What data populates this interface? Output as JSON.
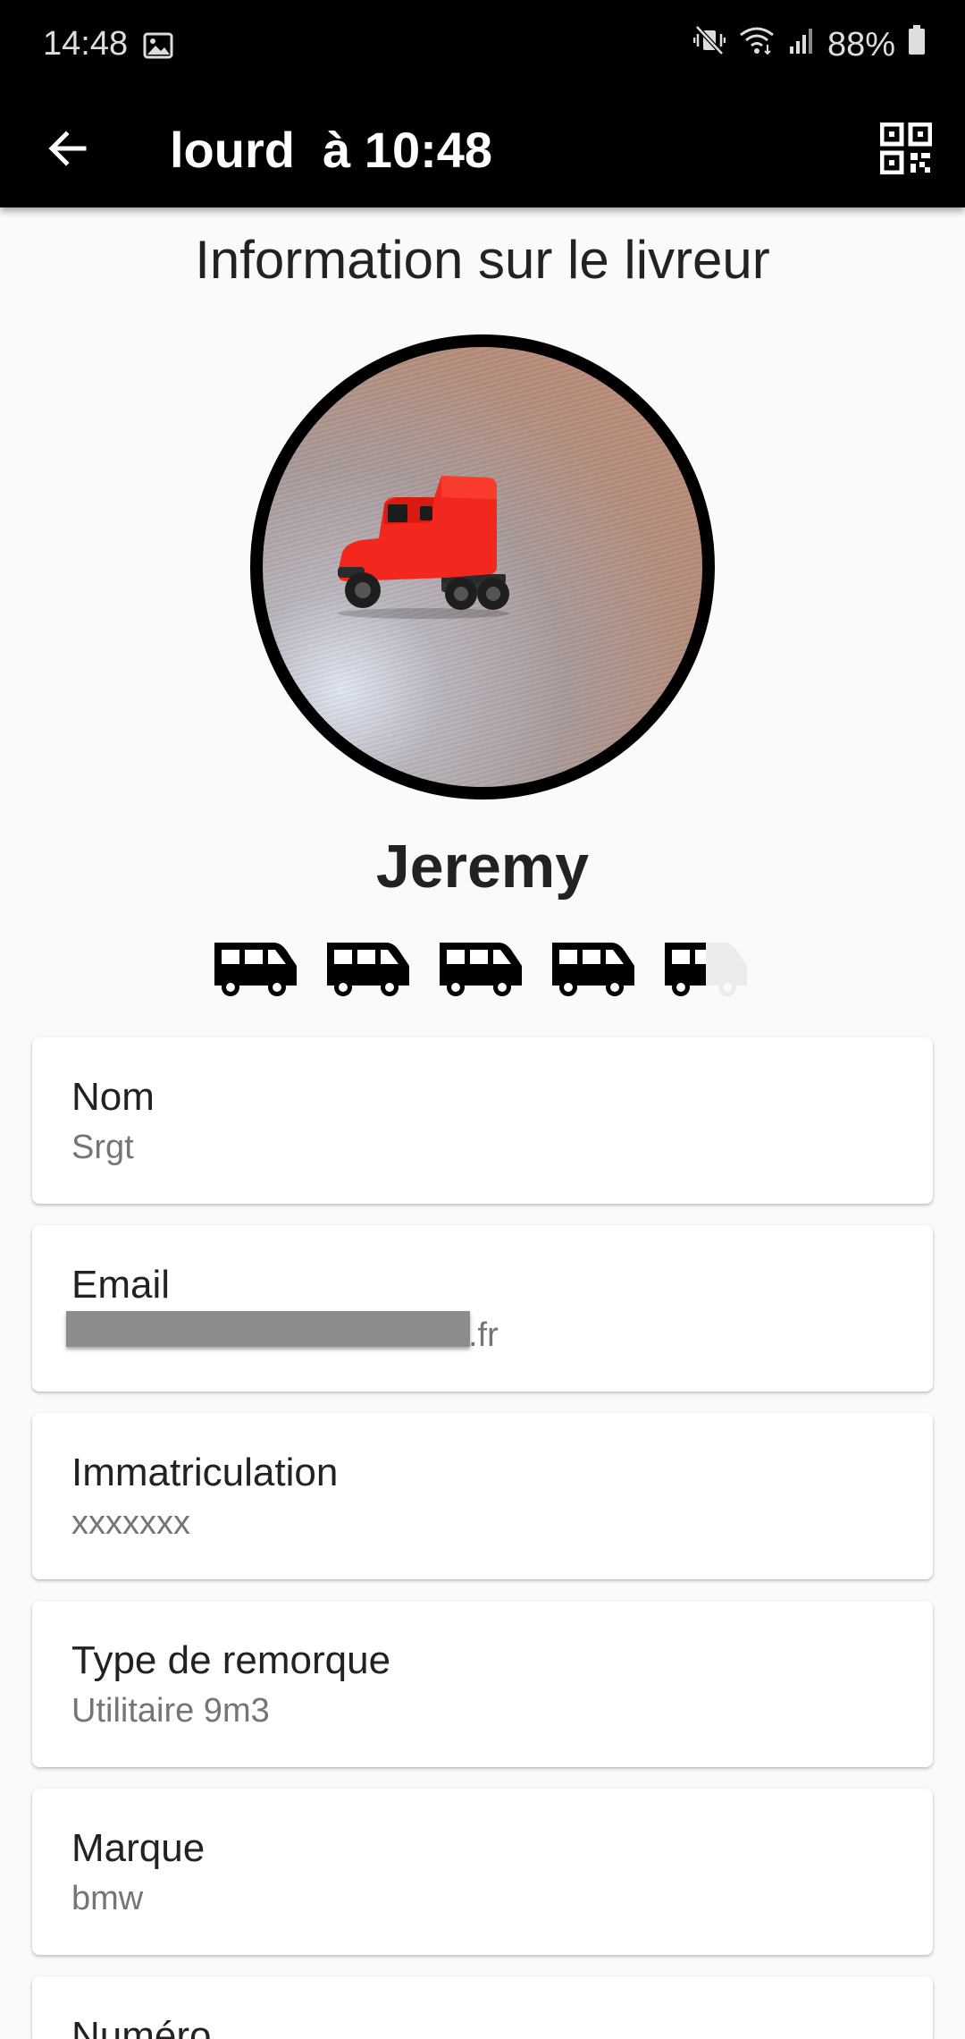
{
  "status_bar": {
    "time": "14:48",
    "battery": "88%",
    "icons": [
      "image-icon",
      "mute-vibrate-icon",
      "wifi-icon",
      "signal-icon",
      "battery-icon"
    ]
  },
  "app_bar": {
    "title": "lourd  à 10:48",
    "back_icon": "arrow-left-icon",
    "action_icon": "qr-code-icon"
  },
  "profile": {
    "section_title": "Information sur le livreur",
    "name": "Jeremy",
    "rating": {
      "value": 4.5,
      "max": 5,
      "icon": "van-icon"
    }
  },
  "fields": [
    {
      "label": "Nom",
      "value": "Srgt"
    },
    {
      "label": "Email",
      "value": ".fr",
      "redacted": true
    },
    {
      "label": "Immatriculation",
      "value": "xxxxxxx"
    },
    {
      "label": "Type de remorque",
      "value": "Utilitaire 9m3"
    },
    {
      "label": "Marque",
      "value": "bmw"
    },
    {
      "label": "Numéro",
      "value": ""
    }
  ],
  "colors": {
    "app_bar": "#000000",
    "background": "#fafafa",
    "truck_cab": "#f2281e",
    "avatar_border": "#000000",
    "rating_empty": "#ececec"
  }
}
